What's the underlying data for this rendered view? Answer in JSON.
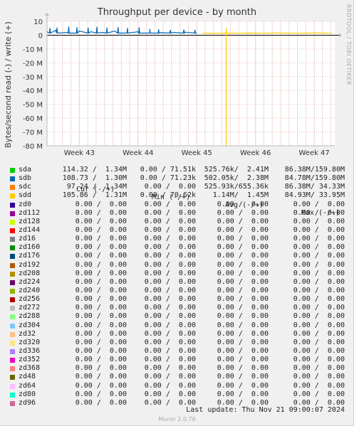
{
  "title": "Throughput per device - by month",
  "watermark": "RRDTOOL / TOBI OETIKER",
  "ylabel": "Bytes/second read (-) / write (+)",
  "header": {
    "cur": "Cur (-/+)",
    "min": "Min (-/+)",
    "avg": "Avg (-/+)",
    "max": "Max (-/+)"
  },
  "last_update": "Last update:  Thu Nov 21 09:00:07 2024",
  "munin": "Munin 2.0.76",
  "legend": [
    {
      "name": "sda",
      "color": "#00cc00",
      "cur": "114.32 /  1.34M",
      "min": "0.00 / 71.51k",
      "avg": "525.76k/  2.41M",
      "max": "86.38M/159.80M"
    },
    {
      "name": "sdb",
      "color": "#0066b3",
      "cur": "108.73 /  1.30M",
      "min": "0.00 / 71.23k",
      "avg": "502.05k/  2.38M",
      "max": "84.78M/159.80M"
    },
    {
      "name": "sdc",
      "color": "#ff8000",
      "cur": " 97.24 /  1.34M",
      "min": "0.00 /  0.00",
      "avg": "525.93k/655.36k",
      "max": "86.38M/ 34.33M"
    },
    {
      "name": "sdd",
      "color": "#ffcc00",
      "cur": "105.86 /  1.31M",
      "min": "0.00 / 70.62k",
      "avg": "  1.14M/  1.45M",
      "max": "84.93M/ 33.95M"
    },
    {
      "name": "zd0",
      "color": "#330099",
      "cur": "  0.00 /  0.00",
      "min": "0.00 /  0.00",
      "avg": "  0.00 /  0.00",
      "max": "  0.00 /  0.00"
    },
    {
      "name": "zd112",
      "color": "#990099",
      "cur": "  0.00 /  0.00",
      "min": "0.00 /  0.00",
      "avg": "  0.00 /  0.00",
      "max": "  0.00 /  0.00"
    },
    {
      "name": "zd128",
      "color": "#ccff00",
      "cur": "  0.00 /  0.00",
      "min": "0.00 /  0.00",
      "avg": "  0.00 /  0.00",
      "max": "  0.00 /  0.00"
    },
    {
      "name": "zd144",
      "color": "#ff0000",
      "cur": "  0.00 /  0.00",
      "min": "0.00 /  0.00",
      "avg": "  0.00 /  0.00",
      "max": "  0.00 /  0.00"
    },
    {
      "name": "zd16",
      "color": "#808080",
      "cur": "  0.00 /  0.00",
      "min": "0.00 /  0.00",
      "avg": "  0.00 /  0.00",
      "max": "  0.00 /  0.00"
    },
    {
      "name": "zd160",
      "color": "#008f00",
      "cur": "  0.00 /  0.00",
      "min": "0.00 /  0.00",
      "avg": "  0.00 /  0.00",
      "max": "  0.00 /  0.00"
    },
    {
      "name": "zd176",
      "color": "#00487d",
      "cur": "  0.00 /  0.00",
      "min": "0.00 /  0.00",
      "avg": "  0.00 /  0.00",
      "max": "  0.00 /  0.00"
    },
    {
      "name": "zd192",
      "color": "#b35a00",
      "cur": "  0.00 /  0.00",
      "min": "0.00 /  0.00",
      "avg": "  0.00 /  0.00",
      "max": "  0.00 /  0.00"
    },
    {
      "name": "zd208",
      "color": "#b38f00",
      "cur": "  0.00 /  0.00",
      "min": "0.00 /  0.00",
      "avg": "  0.00 /  0.00",
      "max": "  0.00 /  0.00"
    },
    {
      "name": "zd224",
      "color": "#6b006b",
      "cur": "  0.00 /  0.00",
      "min": "0.00 /  0.00",
      "avg": "  0.00 /  0.00",
      "max": "  0.00 /  0.00"
    },
    {
      "name": "zd240",
      "color": "#8fb300",
      "cur": "  0.00 /  0.00",
      "min": "0.00 /  0.00",
      "avg": "  0.00 /  0.00",
      "max": "  0.00 /  0.00"
    },
    {
      "name": "zd256",
      "color": "#b30000",
      "cur": "  0.00 /  0.00",
      "min": "0.00 /  0.00",
      "avg": "  0.00 /  0.00",
      "max": "  0.00 /  0.00"
    },
    {
      "name": "zd272",
      "color": "#bebebe",
      "cur": "  0.00 /  0.00",
      "min": "0.00 /  0.00",
      "avg": "  0.00 /  0.00",
      "max": "  0.00 /  0.00"
    },
    {
      "name": "zd288",
      "color": "#80ff80",
      "cur": "  0.00 /  0.00",
      "min": "0.00 /  0.00",
      "avg": "  0.00 /  0.00",
      "max": "  0.00 /  0.00"
    },
    {
      "name": "zd304",
      "color": "#80c9ff",
      "cur": "  0.00 /  0.00",
      "min": "0.00 /  0.00",
      "avg": "  0.00 /  0.00",
      "max": "  0.00 /  0.00"
    },
    {
      "name": "zd32",
      "color": "#ffc080",
      "cur": "  0.00 /  0.00",
      "min": "0.00 /  0.00",
      "avg": "  0.00 /  0.00",
      "max": "  0.00 /  0.00"
    },
    {
      "name": "zd320",
      "color": "#ffe680",
      "cur": "  0.00 /  0.00",
      "min": "0.00 /  0.00",
      "avg": "  0.00 /  0.00",
      "max": "  0.00 /  0.00"
    },
    {
      "name": "zd336",
      "color": "#aa80ff",
      "cur": "  0.00 /  0.00",
      "min": "0.00 /  0.00",
      "avg": "  0.00 /  0.00",
      "max": "  0.00 /  0.00"
    },
    {
      "name": "zd352",
      "color": "#ee00cc",
      "cur": "  0.00 /  0.00",
      "min": "0.00 /  0.00",
      "avg": "  0.00 /  0.00",
      "max": "  0.00 /  0.00"
    },
    {
      "name": "zd368",
      "color": "#ff8080",
      "cur": "  0.00 /  0.00",
      "min": "0.00 /  0.00",
      "avg": "  0.00 /  0.00",
      "max": "  0.00 /  0.00"
    },
    {
      "name": "zd48",
      "color": "#666600",
      "cur": "  0.00 /  0.00",
      "min": "0.00 /  0.00",
      "avg": "  0.00 /  0.00",
      "max": "  0.00 /  0.00"
    },
    {
      "name": "zd64",
      "color": "#ffbfff",
      "cur": "  0.00 /  0.00",
      "min": "0.00 /  0.00",
      "avg": "  0.00 /  0.00",
      "max": "  0.00 /  0.00"
    },
    {
      "name": "zd80",
      "color": "#00ffcc",
      "cur": "  0.00 /  0.00",
      "min": "0.00 /  0.00",
      "avg": "  0.00 /  0.00",
      "max": "  0.00 /  0.00"
    },
    {
      "name": "zd96",
      "color": "#cc6699",
      "cur": "  0.00 /  0.00",
      "min": "0.00 /  0.00",
      "avg": "  0.00 /  0.00",
      "max": "  0.00 /  0.00"
    }
  ],
  "chart_data": {
    "type": "line",
    "title": "Throughput per device - by month",
    "ylabel": "Bytes/second read (-) / write (+)",
    "y_unit": "M",
    "ylim": [
      -80,
      10
    ],
    "y_ticks": [
      10,
      0,
      -10,
      -20,
      -30,
      -40,
      -50,
      -60,
      -70,
      -80
    ],
    "y_tick_labels": [
      "10",
      "0",
      "-10 M",
      "-20 M",
      "-30 M",
      "-40 M",
      "-50 M",
      "-60 M",
      "-70 M",
      "-80 M"
    ],
    "xlim": [
      42.45,
      47.35
    ],
    "x_ticks": [
      43,
      44,
      45,
      46,
      47
    ],
    "x_tick_labels": [
      "Week 43",
      "Week 44",
      "Week 45",
      "Week 46",
      "Week 47"
    ],
    "grid": true,
    "series": [
      {
        "name": "sda",
        "color": "#0066b3",
        "x": [
          42.45,
          42.6,
          42.8,
          43.0,
          43.2,
          43.4,
          43.6,
          43.8,
          44.0,
          44.2,
          44.4,
          44.6,
          44.8,
          45.0
        ],
        "y": [
          2.5,
          3.5,
          2.0,
          3.0,
          2.5,
          2.0,
          3.0,
          1.5,
          2.5,
          2.0,
          1.8,
          2.0,
          2.2,
          1.2
        ],
        "spikes": [
          {
            "x": 42.5,
            "y": 5.2
          },
          {
            "x": 42.62,
            "y": 5.5
          },
          {
            "x": 42.82,
            "y": 6.2
          },
          {
            "x": 42.96,
            "y": 5.8
          },
          {
            "x": 43.15,
            "y": 5.4
          },
          {
            "x": 43.3,
            "y": 6.0
          },
          {
            "x": 43.47,
            "y": 5.5
          },
          {
            "x": 43.66,
            "y": 5.8
          },
          {
            "x": 43.82,
            "y": 5.2
          },
          {
            "x": 44.02,
            "y": 5.6
          },
          {
            "x": 44.2,
            "y": 4.5
          },
          {
            "x": 44.35,
            "y": 4.2
          },
          {
            "x": 44.55,
            "y": 3.8
          },
          {
            "x": 44.78,
            "y": 4.0
          },
          {
            "x": 44.97,
            "y": 3.8
          }
        ]
      },
      {
        "name": "sdd",
        "color": "#ffcc00",
        "x": [
          45.1,
          45.3,
          45.5,
          45.7,
          45.9,
          46.1,
          46.3,
          46.5,
          46.7,
          46.9,
          47.1,
          47.3
        ],
        "y": [
          1.5,
          1.3,
          1.6,
          1.4,
          1.5,
          1.4,
          1.6,
          1.5,
          1.4,
          1.5,
          1.6,
          1.4
        ],
        "spikes": [
          {
            "x": 45.5,
            "y": -80
          },
          {
            "x": 45.5,
            "y": 5.0
          }
        ]
      }
    ]
  }
}
